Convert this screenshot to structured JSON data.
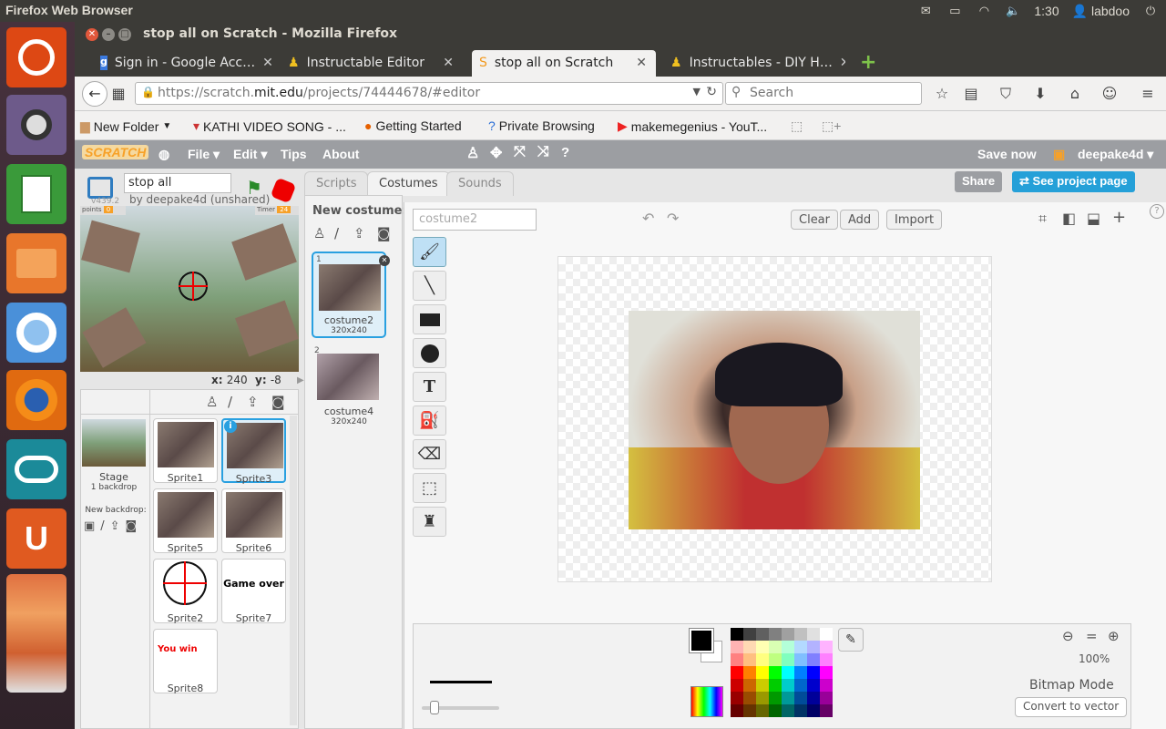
{
  "os": {
    "panel_title": "Firefox Web Browser",
    "clock": "1:30",
    "user": "labdoo"
  },
  "browser": {
    "window_title": "stop all on Scratch - Mozilla Firefox",
    "tabs": [
      {
        "label": "Sign in - Google Acc…",
        "active": false
      },
      {
        "label": "Instructable Editor",
        "active": false
      },
      {
        "label": "stop all on Scratch",
        "active": true
      },
      {
        "label": "Instructables - DIY H…",
        "active": false
      }
    ],
    "url_prefix": "https://scratch.",
    "url_domain": "mit.edu",
    "url_path": "/projects/74444678/#editor",
    "search_placeholder": "Search",
    "bookmarks": [
      "New Folder",
      "KATHI VIDEO SONG - ...",
      "Getting Started",
      "Private Browsing",
      "makemegenius - YouT..."
    ]
  },
  "scratch": {
    "logo": "SCRATCH",
    "menu": {
      "file": "File",
      "edit": "Edit",
      "tips": "Tips",
      "about": "About"
    },
    "save_now": "Save now",
    "username": "deepake4d",
    "share": "Share",
    "see_project_page": "See project page",
    "project_title": "stop all",
    "version": "v439.2",
    "byline": "by deepake4d (unshared)",
    "stage_readout_points": "points",
    "stage_readout_timer": "Timer",
    "coords": {
      "x_label": "x:",
      "x": "240",
      "y_label": "y:",
      "y": "-8"
    },
    "tabs": {
      "scripts": "Scripts",
      "costumes": "Costumes",
      "sounds": "Sounds"
    },
    "new_costume": "New costume:",
    "costumes": [
      {
        "num": "1",
        "name": "costume2",
        "size": "320x240"
      },
      {
        "num": "2",
        "name": "costume4",
        "size": "320x240"
      }
    ],
    "costume_name_placeholder": "costume2",
    "paint_buttons": {
      "clear": "Clear",
      "add": "Add",
      "import": "Import"
    },
    "zoom": "100%",
    "mode": "Bitmap Mode",
    "convert": "Convert to vector",
    "stage_label": "Stage",
    "backdrops": "1 backdrop",
    "new_backdrop": "New backdrop:",
    "sprites": [
      "Sprite1",
      "Sprite3",
      "Sprite5",
      "Sprite6",
      "Sprite2",
      "Sprite7",
      "Sprite8"
    ],
    "sprite7_text": "Game over",
    "sprite8_text": "You win",
    "palette": [
      "#000000",
      "#404040",
      "#606060",
      "#808080",
      "#a0a0a0",
      "#c0c0c0",
      "#e0e0e0",
      "#ffffff",
      "#ffb3b3",
      "#ffd9b3",
      "#ffffb3",
      "#d9ffb3",
      "#b3ffd9",
      "#b3d9ff",
      "#b3b3ff",
      "#ffb3ff",
      "#ff8080",
      "#ffbf80",
      "#ffff80",
      "#bfff80",
      "#80ffbf",
      "#80bfff",
      "#8080ff",
      "#ff80ff",
      "#ff0000",
      "#ff8000",
      "#ffff00",
      "#00ff00",
      "#00ffff",
      "#0080ff",
      "#0000ff",
      "#ff00ff",
      "#cc0000",
      "#cc6600",
      "#cccc00",
      "#00cc00",
      "#00cccc",
      "#0066cc",
      "#0000cc",
      "#cc00cc",
      "#990000",
      "#994c00",
      "#999900",
      "#009900",
      "#009999",
      "#004c99",
      "#000099",
      "#990099",
      "#660000",
      "#663300",
      "#666600",
      "#006600",
      "#006666",
      "#003366",
      "#000066",
      "#660066"
    ]
  }
}
